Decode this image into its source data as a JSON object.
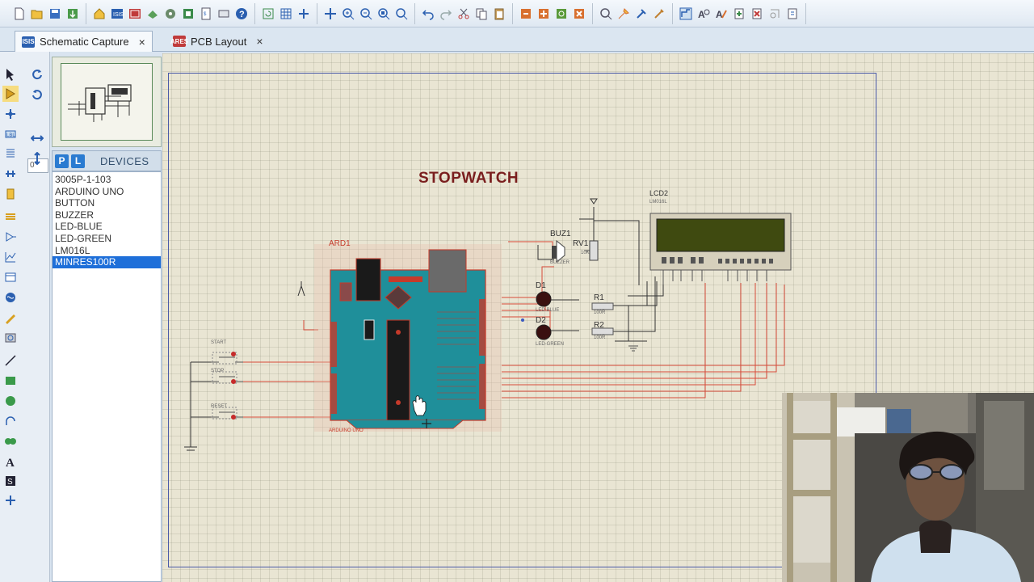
{
  "tabs": [
    {
      "label": "Schematic Capture",
      "icon": "ISIS",
      "close": "×"
    },
    {
      "label": "PCB Layout",
      "icon": "ARES",
      "close": "×"
    }
  ],
  "left_panel": {
    "rotation_value": "0°",
    "pick_button": "P",
    "library_button": "L",
    "devices_title": "DEVICES",
    "devices": [
      "3005P-1-103",
      "ARDUINO UNO",
      "BUTTON",
      "BUZZER",
      "LED-BLUE",
      "LED-GREEN",
      "LM016L",
      "MINRES100R"
    ],
    "selected_device": "MINRES100R"
  },
  "schematic": {
    "title": "STOPWATCH",
    "arduino_ref": "ARD1",
    "arduino_value": "ARDUINO UNO",
    "buzzer_ref": "BUZ1",
    "buzzer_value": "BUZZER",
    "pot_ref": "RV1",
    "pot_value": "10K",
    "lcd_ref": "LCD2",
    "lcd_value": "LM016L",
    "led1_ref": "D1",
    "led1_value": "LED-BLUE",
    "led2_ref": "D2",
    "led2_value": "LED-GREEN",
    "r1_ref": "R1",
    "r1_value": "100R",
    "r2_ref": "R2",
    "r2_value": "100R",
    "btn_start": "START",
    "btn_stop": "STOP",
    "btn_reset": "RESET"
  },
  "colors": {
    "board": "#1f8f9a",
    "wire": "#d84a3a",
    "lcd_screen": "#3f4a10",
    "sheet_border": "#4a5aa8"
  }
}
